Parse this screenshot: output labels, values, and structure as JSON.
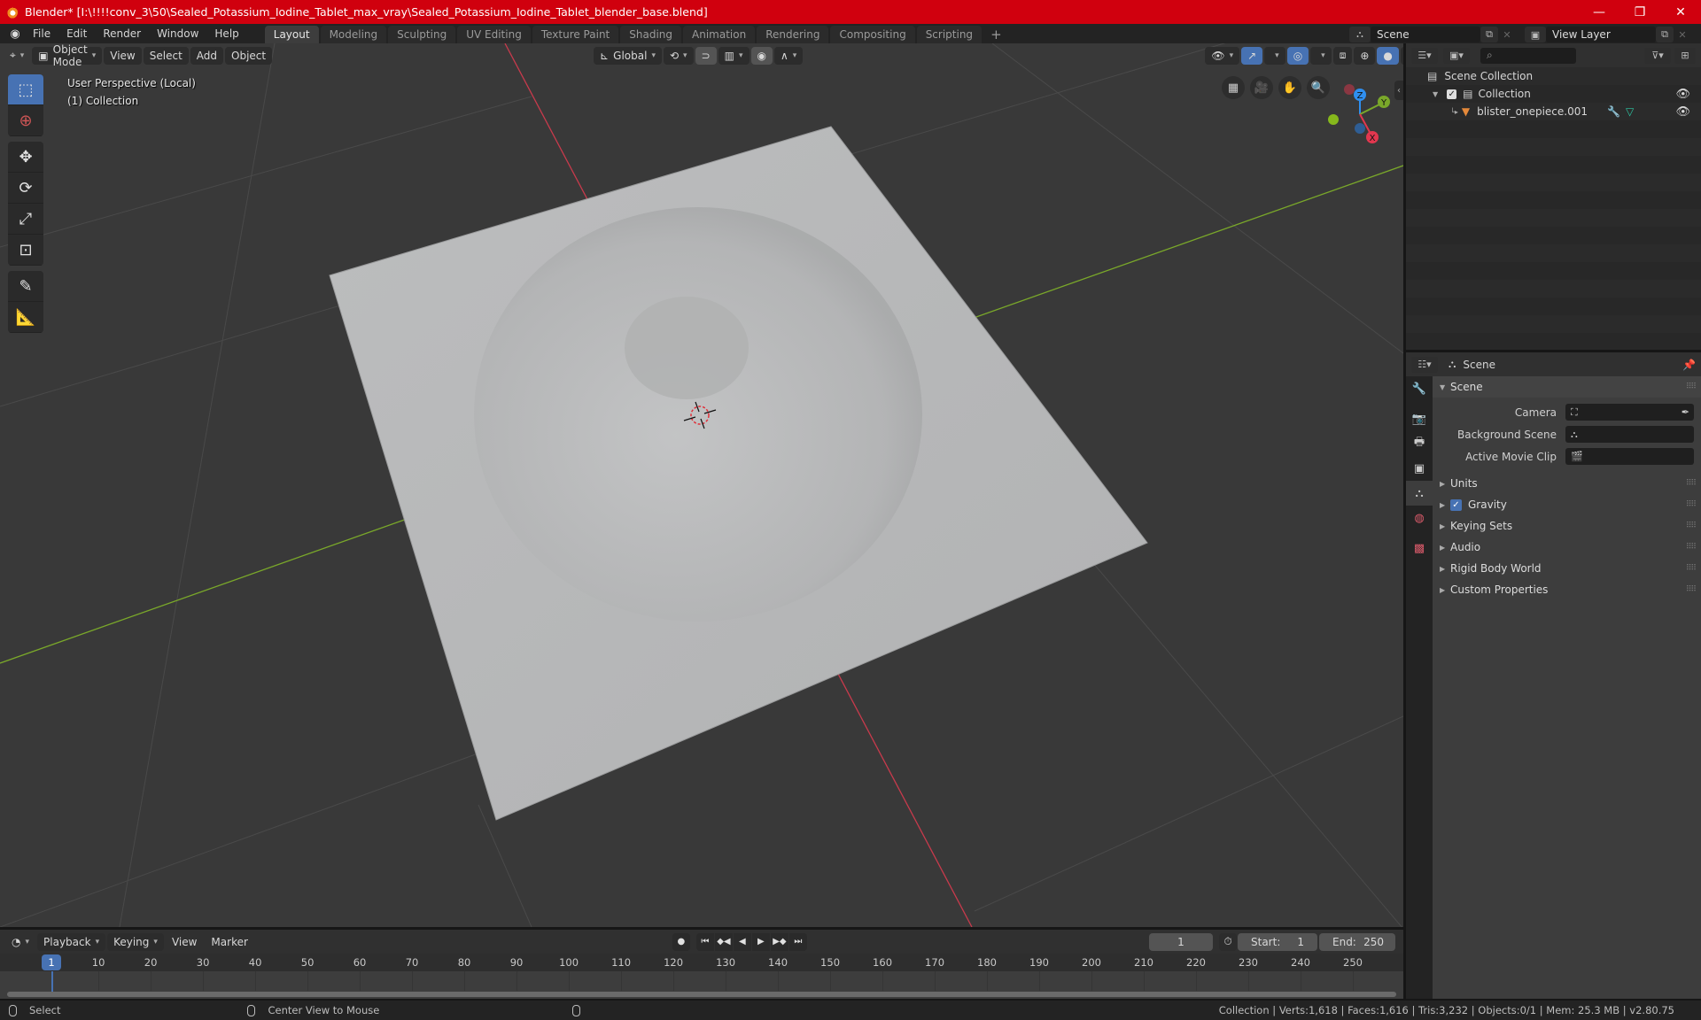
{
  "titlebar": {
    "title": "Blender* [I:\\!!!!conv_3\\50\\Sealed_Potassium_Iodine_Tablet_max_vray\\Sealed_Potassium_Iodine_Tablet_blender_base.blend]",
    "minimize": "—",
    "maximize": "❐",
    "close": "✕"
  },
  "menu": {
    "items": [
      "File",
      "Edit",
      "Render",
      "Window",
      "Help"
    ]
  },
  "workspaces": {
    "tabs": [
      "Layout",
      "Modeling",
      "Sculpting",
      "UV Editing",
      "Texture Paint",
      "Shading",
      "Animation",
      "Rendering",
      "Compositing",
      "Scripting"
    ],
    "active": "Layout",
    "add": "+"
  },
  "scene_selector": {
    "value": "Scene"
  },
  "view_layer_selector": {
    "value": "View Layer"
  },
  "viewport_header": {
    "mode": "Object Mode",
    "menus": [
      "View",
      "Select",
      "Add",
      "Object"
    ],
    "transform_orientation": "Global"
  },
  "viewport": {
    "perspective": "User Perspective (Local)",
    "collection": "(1) Collection",
    "gizmo_axes": {
      "x": "X",
      "y": "Y",
      "z": "Z"
    },
    "colors": {
      "x_axis": "#c83a4c",
      "y_axis": "#7aa82a",
      "plane": "#b7b8b9",
      "background": "#393939"
    }
  },
  "outliner": {
    "search_placeholder": "",
    "rows": [
      {
        "label": "Scene Collection",
        "icon": "collection-icon"
      },
      {
        "label": "Collection",
        "icon": "collection-icon",
        "checked": true,
        "visible": true
      },
      {
        "label": "blister_onepiece.001",
        "icon": "mesh-object-icon",
        "visible": true
      }
    ]
  },
  "properties": {
    "context": "Scene",
    "panel_title": "Scene",
    "fields": [
      {
        "label": "Camera",
        "value": ""
      },
      {
        "label": "Background Scene",
        "value": ""
      },
      {
        "label": "Active Movie Clip",
        "value": ""
      }
    ],
    "collapsed_panels": [
      {
        "label": "Units"
      },
      {
        "label": "Gravity",
        "checkbox": true
      },
      {
        "label": "Keying Sets"
      },
      {
        "label": "Audio"
      },
      {
        "label": "Rigid Body World"
      },
      {
        "label": "Custom Properties"
      }
    ]
  },
  "timeline": {
    "menus": [
      "Playback",
      "Keying",
      "View",
      "Marker"
    ],
    "current_frame": "1",
    "start_label": "Start:",
    "start": "1",
    "end_label": "End:",
    "end": "250",
    "ticks": [
      "10",
      "20",
      "30",
      "40",
      "50",
      "60",
      "70",
      "80",
      "90",
      "100",
      "110",
      "120",
      "130",
      "140",
      "150",
      "160",
      "170",
      "180",
      "190",
      "200",
      "210",
      "220",
      "230",
      "240",
      "250"
    ],
    "cursor_frame": "1"
  },
  "statusbar": {
    "left_action": "Select",
    "middle_action": "Center View to Mouse",
    "stats": "Collection | Verts:1,618 | Faces:1,616 | Tris:3,232 | Objects:0/1 | Mem: 25.3 MB | v2.80.75"
  }
}
